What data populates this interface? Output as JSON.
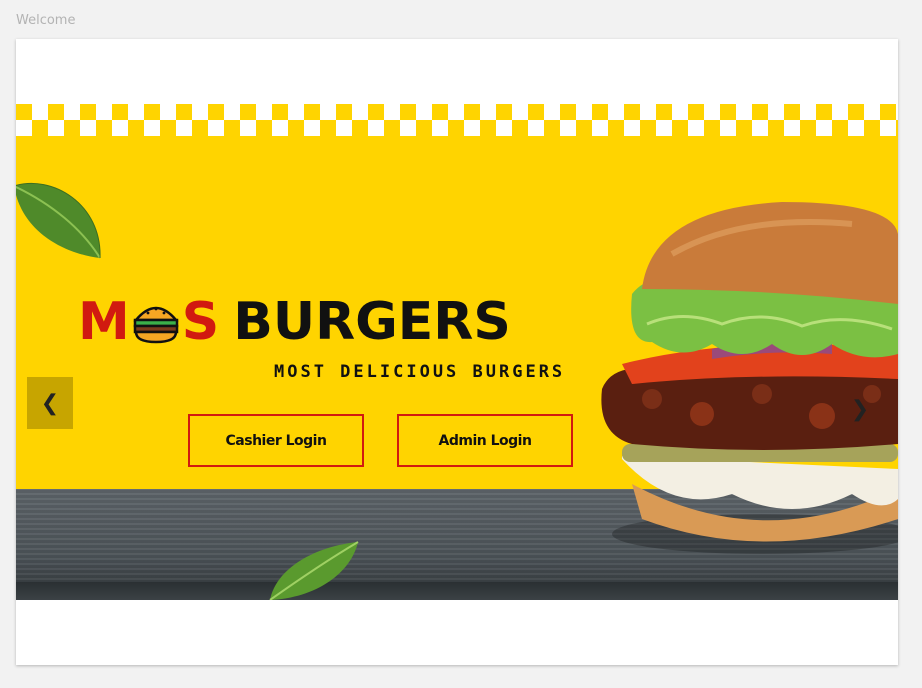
{
  "window": {
    "title": "Welcome"
  },
  "brand": {
    "logo_left": "M",
    "logo_right": "S",
    "logo_word": "BURGERS",
    "tagline": "MOST DELICIOUS BURGERS"
  },
  "buttons": {
    "cashier_label": "Cashier Login",
    "admin_label": "Admin Login"
  },
  "carousel": {
    "prev_glyph": "❮",
    "next_glyph": "❯"
  },
  "colors": {
    "banner_yellow": "#ffd400",
    "brand_red": "#d11a10",
    "text_dark": "#111111"
  },
  "icons": [
    "burger-icon",
    "chevron-left-icon",
    "chevron-right-icon",
    "leaf-icon"
  ]
}
